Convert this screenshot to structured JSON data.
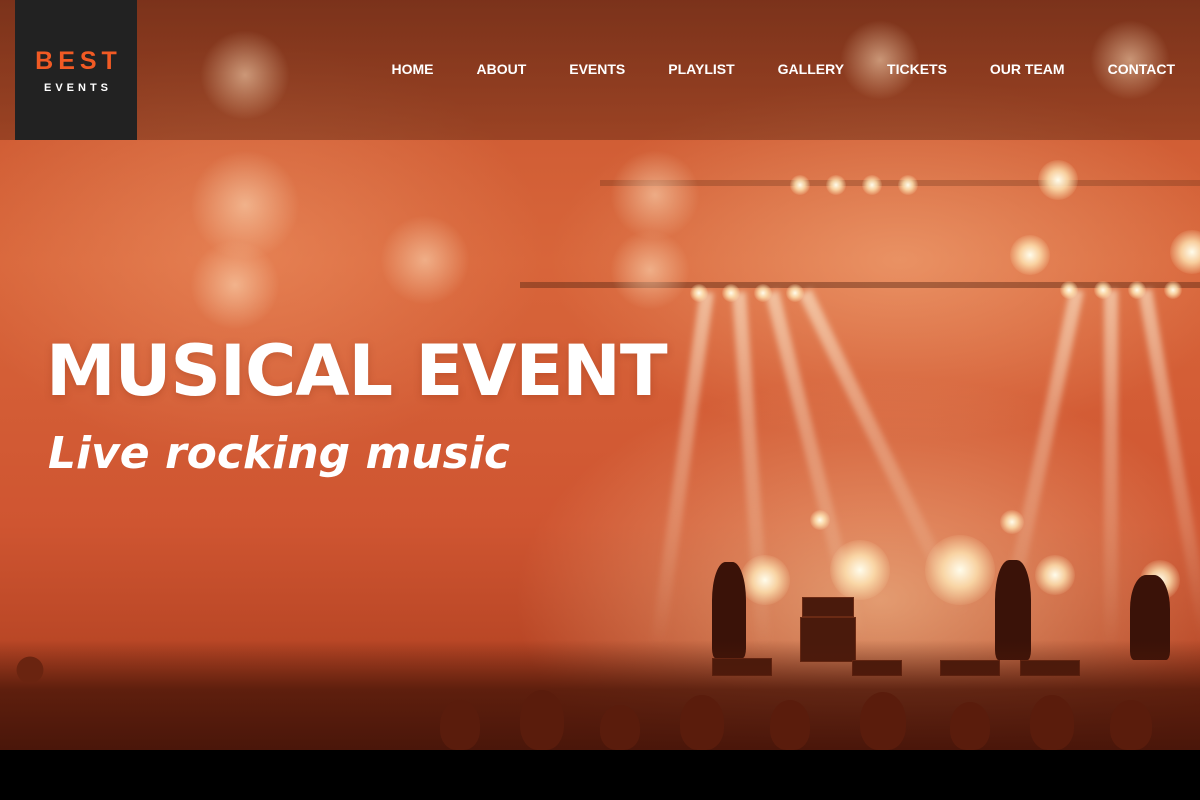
{
  "brand": {
    "name": "BEST",
    "tagline": "EVENTS",
    "accent_color": "#f15a24"
  },
  "nav": {
    "items": [
      {
        "label": "HOME"
      },
      {
        "label": "ABOUT"
      },
      {
        "label": "EVENTS"
      },
      {
        "label": "PLAYLIST"
      },
      {
        "label": "GALLERY"
      },
      {
        "label": "TICKETS"
      },
      {
        "label": "OUR TEAM"
      },
      {
        "label": "CONTACT"
      }
    ]
  },
  "hero": {
    "title": "MUSICAL EVENT",
    "subtitle": "Live rocking music",
    "background_description_icon": "concert-stage-photo"
  }
}
